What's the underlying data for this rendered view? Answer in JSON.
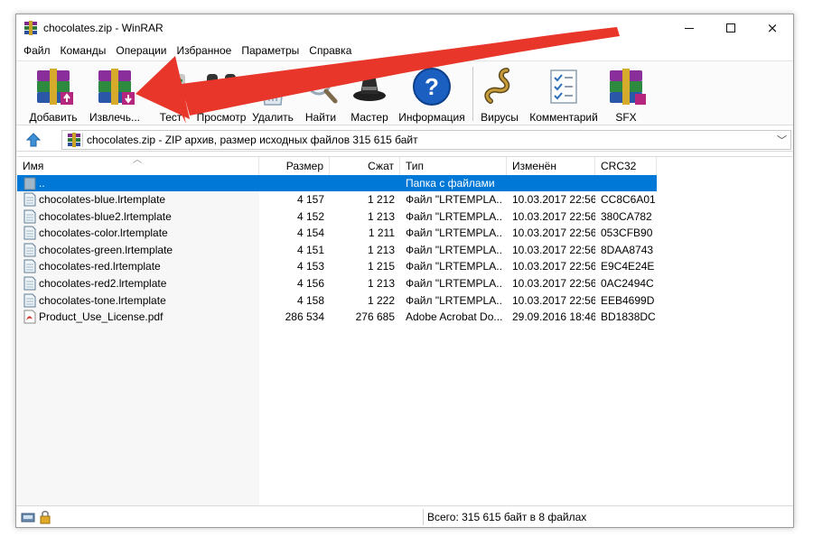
{
  "window": {
    "title": "chocolates.zip - WinRAR",
    "controls": {
      "minimize": "minimize-icon",
      "maximize": "maximize-icon",
      "close": "×"
    }
  },
  "menu": [
    "Файл",
    "Команды",
    "Операции",
    "Избранное",
    "Параметры",
    "Справка"
  ],
  "toolbar": [
    {
      "label": "Добавить",
      "icon": "rar-add-icon"
    },
    {
      "label": "Извлечь...",
      "icon": "rar-extract-icon"
    },
    {
      "label": "Тест",
      "icon": "test-icon"
    },
    {
      "label": "Просмотр",
      "icon": "view-binoculars-icon"
    },
    {
      "label": "Удалить",
      "icon": "delete-trash-icon"
    },
    {
      "label": "Найти",
      "icon": "find-magnifier-icon"
    },
    {
      "label": "Мастер",
      "icon": "wizard-hat-icon"
    },
    {
      "label": "Информация",
      "icon": "info-question-icon"
    },
    {
      "label": "Вирусы",
      "icon": "virus-snake-icon"
    },
    {
      "label": "Комментарий",
      "icon": "comment-checklist-icon"
    },
    {
      "label": "SFX",
      "icon": "sfx-rar-icon"
    }
  ],
  "address": {
    "text": "chocolates.zip - ZIP архив, размер исходных файлов 315 615 байт",
    "dropdown": "﹀"
  },
  "columns": [
    "Имя",
    "Размер",
    "Сжат",
    "Тип",
    "Изменён",
    "CRC32"
  ],
  "sort_indicator": "︿",
  "parent_row": {
    "name": "..",
    "type": "Папка с файлами"
  },
  "files": [
    {
      "name": "chocolates-blue.lrtemplate",
      "size": "4 157",
      "packed": "1 212",
      "type": "Файл \"LRTEMPLA...",
      "modified": "10.03.2017 22:56",
      "crc": "CC8C6A01",
      "icon": "template-file-icon"
    },
    {
      "name": "chocolates-blue2.lrtemplate",
      "size": "4 152",
      "packed": "1 213",
      "type": "Файл \"LRTEMPLA...",
      "modified": "10.03.2017 22:56",
      "crc": "380CA782",
      "icon": "template-file-icon"
    },
    {
      "name": "chocolates-color.lrtemplate",
      "size": "4 154",
      "packed": "1 211",
      "type": "Файл \"LRTEMPLA...",
      "modified": "10.03.2017 22:56",
      "crc": "053CFB90",
      "icon": "template-file-icon"
    },
    {
      "name": "chocolates-green.lrtemplate",
      "size": "4 151",
      "packed": "1 213",
      "type": "Файл \"LRTEMPLA...",
      "modified": "10.03.2017 22:56",
      "crc": "8DAA8743",
      "icon": "template-file-icon"
    },
    {
      "name": "chocolates-red.lrtemplate",
      "size": "4 153",
      "packed": "1 215",
      "type": "Файл \"LRTEMPLA...",
      "modified": "10.03.2017 22:56",
      "crc": "E9C4E24E",
      "icon": "template-file-icon"
    },
    {
      "name": "chocolates-red2.lrtemplate",
      "size": "4 156",
      "packed": "1 213",
      "type": "Файл \"LRTEMPLA...",
      "modified": "10.03.2017 22:56",
      "crc": "0AC2494C",
      "icon": "template-file-icon"
    },
    {
      "name": "chocolates-tone.lrtemplate",
      "size": "4 158",
      "packed": "1 222",
      "type": "Файл \"LRTEMPLA...",
      "modified": "10.03.2017 22:56",
      "crc": "EEB4699D",
      "icon": "template-file-icon"
    },
    {
      "name": "Product_Use_License.pdf",
      "size": "286 534",
      "packed": "276 685",
      "type": "Adobe Acrobat Do...",
      "modified": "29.09.2016 18:46",
      "crc": "BD1838DC",
      "icon": "pdf-file-icon"
    }
  ],
  "status": {
    "text": "Всего: 315 615 байт в 8 файлах"
  },
  "colors": {
    "selection": "#0078d7",
    "annotation_arrow": "#e8362a"
  }
}
